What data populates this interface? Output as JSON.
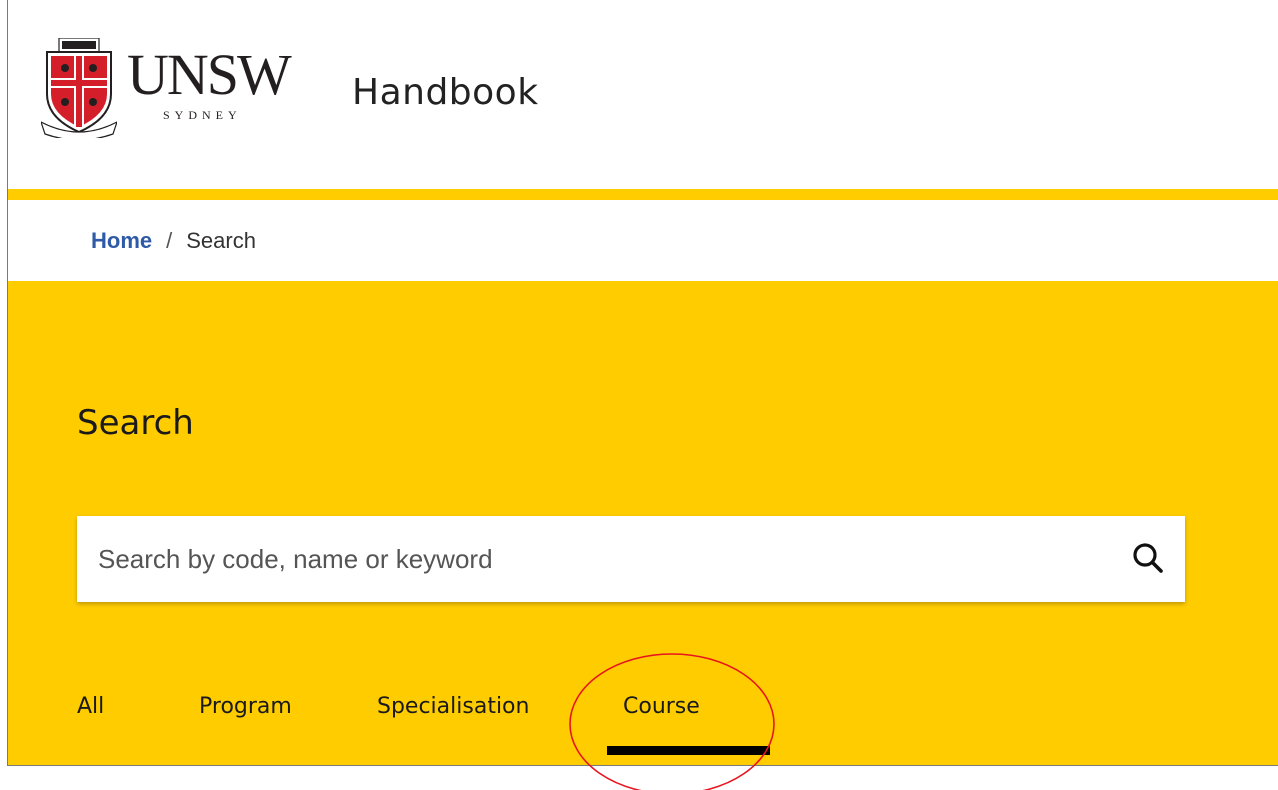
{
  "header": {
    "logo_word": "UNSW",
    "logo_sub": "SYDNEY",
    "app_title": "Handbook"
  },
  "breadcrumb": {
    "home": "Home",
    "separator": "/",
    "current": "Search"
  },
  "hero": {
    "title": "Search",
    "search": {
      "value": "",
      "placeholder": "Search by code, name or keyword"
    }
  },
  "tabs": [
    {
      "label": "All"
    },
    {
      "label": "Program"
    },
    {
      "label": "Specialisation"
    },
    {
      "label": "Course",
      "active": true
    }
  ],
  "colors": {
    "brand_yellow": "#ffcc00",
    "link_blue": "#2e5aa7",
    "annotation_red": "#e8141e"
  }
}
